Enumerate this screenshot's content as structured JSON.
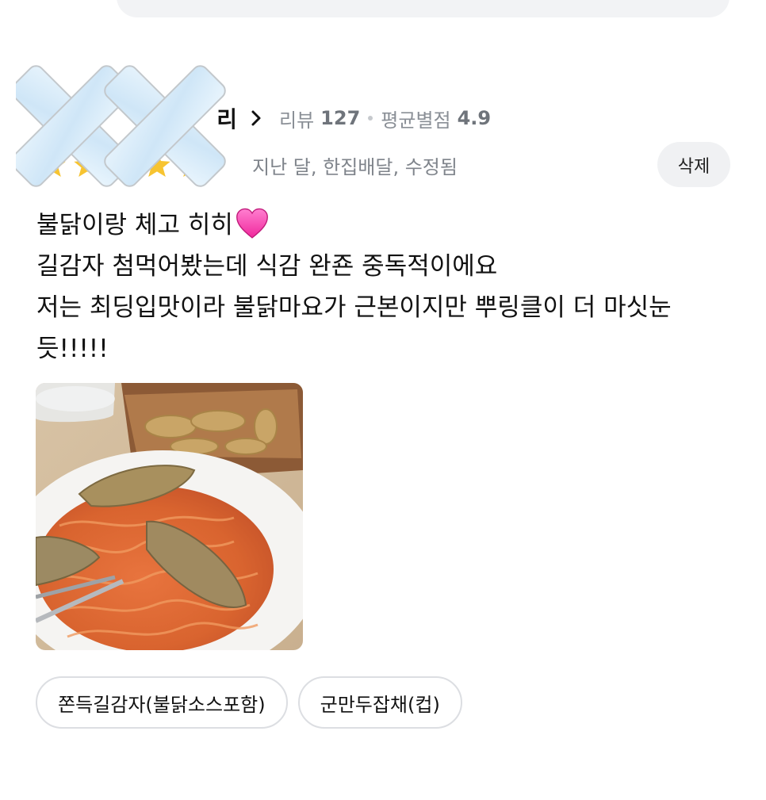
{
  "reviewer": {
    "name": "리",
    "review_label": "리뷰",
    "review_count": "127",
    "avg_label": "평균별점",
    "avg_rating": "4.9"
  },
  "meta": {
    "date": "지난 달",
    "platform": "한집배달",
    "edited": "수정됨",
    "text": "지난 달, 한집배달, 수정됨",
    "star_color": "#f7c431"
  },
  "delete_button": {
    "label": "삭제"
  },
  "review": {
    "line1": "불닭이랑 체고 히히",
    "line2": "길감자 첨먹어봤는데 식감 완죤 중독적이에요",
    "line3": "저는 최딩입맛이라 불닭마요가 근본이지만 뿌링클이 더 마싯눈",
    "line4": "듯!!!!!"
  },
  "menu_chips": [
    {
      "label": "쫀득길감자(불닭소스포함)"
    },
    {
      "label": "군만두잡채(컵)"
    }
  ],
  "icons": {
    "chevron": "chevron-right-icon",
    "heart": "pink-heart-emoji",
    "star": "star-icon"
  },
  "colors": {
    "muted_text": "#8a8f96",
    "chip_border": "#dcdee2",
    "button_bg": "#f0f1f3"
  }
}
